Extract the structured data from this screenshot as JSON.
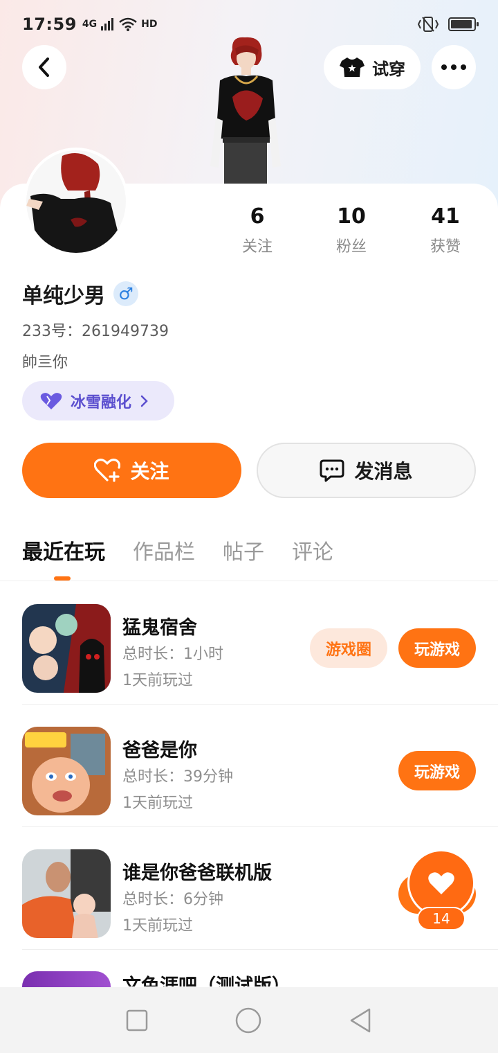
{
  "status_bar": {
    "time": "17:59",
    "network": "4G",
    "hd": "HD"
  },
  "header": {
    "try_on_label": "试穿"
  },
  "stats": [
    {
      "num": "6",
      "label": "关注"
    },
    {
      "num": "10",
      "label": "粉丝"
    },
    {
      "num": "41",
      "label": "获赞"
    }
  ],
  "profile": {
    "username": "单纯少男",
    "gender_symbol": "♂",
    "uid": "233号：261949739",
    "bio": "帥亖你",
    "tag_label": "冰雪融化"
  },
  "actions": {
    "follow_label": "关注",
    "message_label": "发消息"
  },
  "tabs": [
    {
      "label": "最近在玩",
      "active": true
    },
    {
      "label": "作品栏",
      "active": false
    },
    {
      "label": "帖子",
      "active": false
    },
    {
      "label": "评论",
      "active": false
    }
  ],
  "games": [
    {
      "title": "猛鬼宿舍",
      "duration": "总时长：1小时",
      "last_played": "1天前玩过",
      "circle_label": "游戏圈",
      "play_label": "玩游戏"
    },
    {
      "title": "爸爸是你",
      "duration": "总时长：39分钟",
      "last_played": "1天前玩过",
      "play_label": "玩游戏"
    },
    {
      "title": "谁是你爸爸联机版",
      "duration": "总时长：6分钟",
      "last_played": "1天前玩过"
    }
  ],
  "peek_game_title": "文色涯吧（测试版）",
  "fab": {
    "count": "14"
  },
  "colors": {
    "accent": "#ff7313",
    "tag_purple": "#5b4fcf"
  }
}
